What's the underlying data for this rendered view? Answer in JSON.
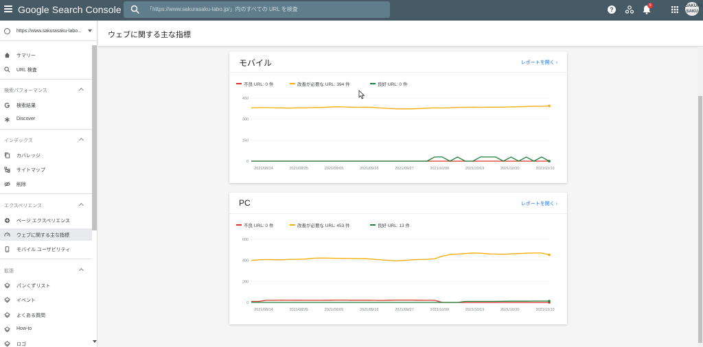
{
  "app": {
    "title": "Google Search Console",
    "search_placeholder": "「https://www.sakurasaku-labo.jp/」内のすべての URL を検査",
    "notification_count": "5",
    "avatar_text": "SAKURA\nSAKU"
  },
  "sidebar": {
    "property": "https://www.sakurasaku-labo...",
    "items": [
      {
        "label": "サマリー",
        "icon": "home-icon"
      },
      {
        "label": "URL 検査",
        "icon": "search-icon"
      }
    ],
    "sections": [
      {
        "title": "検索パフォーマンス",
        "items": [
          {
            "label": "検索結果",
            "icon": "google-g-icon"
          },
          {
            "label": "Discover",
            "icon": "asterisk-icon"
          }
        ]
      },
      {
        "title": "インデックス",
        "items": [
          {
            "label": "カバレッジ",
            "icon": "copy-icon"
          },
          {
            "label": "サイトマップ",
            "icon": "sitemap-icon"
          },
          {
            "label": "削除",
            "icon": "eye-off-icon"
          }
        ]
      },
      {
        "title": "エクスペリエンス",
        "items": [
          {
            "label": "ページ エクスペリエンス",
            "icon": "plus-circle-icon"
          },
          {
            "label": "ウェブに関する主な指標",
            "icon": "gauge-icon"
          },
          {
            "label": "モバイル ユーザビリティ",
            "icon": "phone-icon"
          }
        ]
      },
      {
        "title": "拡張",
        "items": [
          {
            "label": "パンくずリスト",
            "icon": "layers-icon"
          },
          {
            "label": "イベント",
            "icon": "layers-icon"
          },
          {
            "label": "よくある質問",
            "icon": "layers-icon"
          },
          {
            "label": "How-to",
            "icon": "layers-icon"
          },
          {
            "label": "ロゴ",
            "icon": "layers-icon"
          }
        ]
      }
    ]
  },
  "page": {
    "title": "ウェブに関する主な指標"
  },
  "colors": {
    "poor": "#d93025",
    "needs_improvement": "#f9ab00",
    "good": "#188038",
    "link": "#1a73e8",
    "topbar": "#455a64"
  },
  "cards": [
    {
      "title": "モバイル",
      "link": "レポートを開く",
      "legend": [
        "不良 URL: 0 件",
        "改善が必要な URL: 394 件",
        "良好 URL: 0 件"
      ]
    },
    {
      "title": "PC",
      "link": "レポートを開く",
      "legend": [
        "不良 URL: 0 件",
        "改善が必要な URL: 453 件",
        "良好 URL: 13 件"
      ]
    }
  ],
  "chart_data": [
    {
      "type": "line",
      "x": [
        "2021/08/14",
        "2021/08/25",
        "2021/09/05",
        "2021/09/16",
        "2021/09/27",
        "2021/10/08",
        "2021/10/19",
        "2021/10/30",
        "2021/11/10"
      ],
      "yticks": [
        0,
        150,
        300,
        450
      ],
      "ylim": [
        0,
        450
      ],
      "series": [
        {
          "name": "不良 URL",
          "color": "#d93025",
          "values": [
            0,
            0,
            0,
            0,
            0,
            0,
            0,
            0,
            0,
            0,
            0,
            0,
            0,
            0,
            0,
            0,
            0,
            0,
            0,
            0,
            0,
            0,
            0,
            0,
            0,
            0,
            0,
            0,
            0,
            0,
            0,
            0,
            0,
            0,
            0,
            0,
            0,
            0,
            0,
            0
          ]
        },
        {
          "name": "改善が必要な URL",
          "color": "#f9ab00",
          "values": [
            380,
            382,
            382,
            381,
            380,
            378,
            381,
            380,
            382,
            383,
            385,
            388,
            387,
            385,
            384,
            385,
            383,
            379,
            376,
            373,
            372,
            373,
            375,
            378,
            380,
            379,
            381,
            383,
            384,
            385,
            384,
            385,
            385,
            386,
            387,
            388,
            390,
            392,
            391,
            394
          ]
        },
        {
          "name": "良好 URL",
          "color": "#188038",
          "values": [
            0,
            0,
            0,
            0,
            0,
            0,
            0,
            0,
            0,
            0,
            0,
            0,
            0,
            0,
            0,
            0,
            0,
            0,
            0,
            0,
            0,
            0,
            0,
            0,
            30,
            30,
            0,
            30,
            0,
            0,
            30,
            30,
            30,
            0,
            30,
            0,
            30,
            0,
            30,
            0
          ]
        }
      ]
    },
    {
      "type": "line",
      "x": [
        "2021/08/14",
        "2021/08/25",
        "2021/09/05",
        "2021/09/16",
        "2021/09/27",
        "2021/10/08",
        "2021/10/19",
        "2021/10/30",
        "2021/11/10"
      ],
      "yticks": [
        0,
        200,
        400,
        600
      ],
      "ylim": [
        0,
        600
      ],
      "series": [
        {
          "name": "不良 URL",
          "color": "#d93025",
          "values": [
            10,
            10,
            20,
            20,
            22,
            20,
            21,
            20,
            20,
            20,
            21,
            22,
            22,
            21,
            21,
            21,
            20,
            19,
            21,
            22,
            22,
            22,
            21,
            20,
            20,
            0,
            0,
            0,
            0,
            0,
            0,
            0,
            0,
            0,
            0,
            0,
            0,
            0,
            0,
            0
          ]
        },
        {
          "name": "改善が必要な URL",
          "color": "#f9ab00",
          "values": [
            400,
            405,
            408,
            406,
            405,
            410,
            410,
            412,
            420,
            422,
            421,
            420,
            419,
            418,
            417,
            416,
            410,
            405,
            400,
            395,
            400,
            405,
            408,
            410,
            415,
            440,
            455,
            460,
            465,
            470,
            468,
            462,
            460,
            458,
            462,
            465,
            468,
            470,
            470,
            453
          ]
        },
        {
          "name": "良好 URL",
          "color": "#188038",
          "values": [
            0,
            0,
            0,
            0,
            0,
            0,
            0,
            0,
            0,
            0,
            0,
            0,
            0,
            0,
            0,
            0,
            0,
            0,
            0,
            0,
            0,
            0,
            0,
            0,
            0,
            0,
            0,
            0,
            10,
            10,
            10,
            10,
            10,
            11,
            12,
            12,
            12,
            13,
            13,
            13
          ]
        }
      ]
    }
  ]
}
